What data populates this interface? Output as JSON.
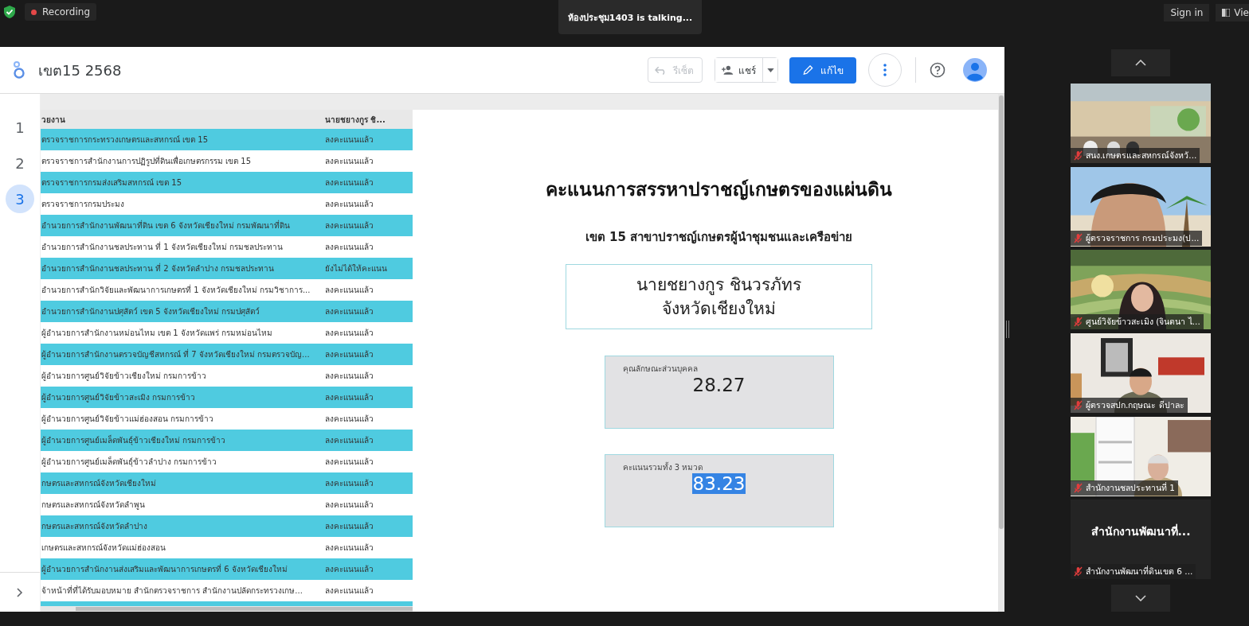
{
  "meeting_bar": {
    "recording": "Recording",
    "speaker": "ห้องประชุม1403 is talking...",
    "sign_in": "Sign in",
    "view": "Vie"
  },
  "report": {
    "title": "เขต15 2568",
    "toolbar": [
      {
        "kind": "reset",
        "label": "รีเซ็ต",
        "disabled": true
      },
      {
        "kind": "share",
        "label": "แชร์",
        "disabled": false
      },
      {
        "kind": "edit",
        "label": "แก้ไข",
        "disabled": false
      }
    ],
    "pages": [
      {
        "label": "1",
        "selected": false
      },
      {
        "label": "2",
        "selected": false
      },
      {
        "label": "3",
        "selected": true
      }
    ],
    "table": {
      "columns": [
        "วยงาน",
        "นายชยางกูร ชิ..."
      ],
      "rows": [
        {
          "cells": [
            "ตรวจราชการกระทรวงเกษตรและสหกรณ์ เขต 15",
            "ลงคะแนนแล้ว"
          ],
          "highlighted": true
        },
        {
          "cells": [
            "ตรวจราชการสำนักงานการปฏิรูปที่ดินเพื่อเกษตรกรรม เขต 15",
            "ลงคะแนนแล้ว"
          ],
          "highlighted": false
        },
        {
          "cells": [
            "ตรวจราชการกรมส่งเสริมสหกรณ์ เขต 15",
            "ลงคะแนนแล้ว"
          ],
          "highlighted": true
        },
        {
          "cells": [
            "ตรวจราชการกรมประมง",
            "ลงคะแนนแล้ว"
          ],
          "highlighted": false
        },
        {
          "cells": [
            "อำนวยการสำนักงานพัฒนาที่ดิน เขต 6 จังหวัดเชียงใหม่ กรมพัฒนาที่ดิน",
            "ลงคะแนนแล้ว"
          ],
          "highlighted": true
        },
        {
          "cells": [
            "อำนวยการสำนักงานชลประทาน ที่ 1 จังหวัดเชียงใหม่ กรมชลประทาน",
            "ลงคะแนนแล้ว"
          ],
          "highlighted": false
        },
        {
          "cells": [
            "อำนวยการสำนักงานชลประทาน ที่ 2 จังหวัดลำปาง กรมชลประทาน",
            "ยังไม่ได้ให้คะแนน"
          ],
          "highlighted": true
        },
        {
          "cells": [
            "อำนวยการสำนักวิจัยและพัฒนาการเกษตรที่ 1 จังหวัดเชียงใหม่ กรมวิชาการ...",
            "ลงคะแนนแล้ว"
          ],
          "highlighted": false
        },
        {
          "cells": [
            "อำนวยการสำนักงานปศุสัตว์ เขต 5 จังหวัดเชียงใหม่ กรมปศุสัตว์",
            "ลงคะแนนแล้ว"
          ],
          "highlighted": true
        },
        {
          "cells": [
            "ผู้อำนวยการสำนักงานหม่อนไหม เขต 1 จังหวัดแพร่ กรมหม่อนไหม",
            "ลงคะแนนแล้ว"
          ],
          "highlighted": false
        },
        {
          "cells": [
            "ผู้อำนวยการสำนักงานตรวจบัญชีสหกรณ์ ที่ 7 จังหวัดเชียงใหม่ กรมตรวจบัญ...",
            "ลงคะแนนแล้ว"
          ],
          "highlighted": true
        },
        {
          "cells": [
            "ผู้อำนวยการศูนย์วิจัยข้าวเชียงใหม่ กรมการข้าว",
            "ลงคะแนนแล้ว"
          ],
          "highlighted": false
        },
        {
          "cells": [
            "ผู้อำนวยการศูนย์วิจัยข้าวสะเมิง กรมการข้าว",
            "ลงคะแนนแล้ว"
          ],
          "highlighted": true
        },
        {
          "cells": [
            "ผู้อำนวยการศูนย์วิจัยข้าวแม่ฮ่องสอน กรมการข้าว",
            "ลงคะแนนแล้ว"
          ],
          "highlighted": false
        },
        {
          "cells": [
            "ผู้อำนวยการศูนย์เมล็ดพันธุ์ข้าวเชียงใหม่ กรมการข้าว",
            "ลงคะแนนแล้ว"
          ],
          "highlighted": true
        },
        {
          "cells": [
            "ผู้อำนวยการศูนย์เมล็ดพันธุ์ข้าวลำปาง กรมการข้าว",
            "ลงคะแนนแล้ว"
          ],
          "highlighted": false
        },
        {
          "cells": [
            "กษตรและสหกรณ์จังหวัดเชียงใหม่",
            "ลงคะแนนแล้ว"
          ],
          "highlighted": true
        },
        {
          "cells": [
            "กษตรและสหกรณ์จังหวัดลำพูน",
            "ลงคะแนนแล้ว"
          ],
          "highlighted": false
        },
        {
          "cells": [
            "กษตรและสหกรณ์จังหวัดลำปาง",
            "ลงคะแนนแล้ว"
          ],
          "highlighted": true
        },
        {
          "cells": [
            "เกษตรและสหกรณ์จังหวัดแม่ฮ่องสอน",
            "ลงคะแนนแล้ว"
          ],
          "highlighted": false
        },
        {
          "cells": [
            "ผู้อำนวยการสำนักงานส่งเสริมและพัฒนาการเกษตรที่ 6 จังหวัดเชียงใหม่",
            "ลงคะแนนแล้ว"
          ],
          "highlighted": true
        },
        {
          "cells": [
            "จ้าหน้าที่ที่ได้รับมอบหมาย สำนักตรวจราชการ สำนักงานปลัดกระทรวงเกษ...",
            "ลงคะแนนแล้ว"
          ],
          "highlighted": false
        }
      ]
    },
    "canvas": {
      "title": "คะแนนการสรรหาปราชญ์เกษตรของแผ่นดิน",
      "subtitle": "เขต 15 สาขาปราชญ์เกษตรผู้นำชุมชนและเครือข่าย",
      "name_lines": [
        "นายชยางกูร ชินวรภัทร",
        "จังหวัดเชียงใหม่"
      ],
      "scores": [
        {
          "label": "คุณลักษณะส่วนบุคคล",
          "value": "28.27",
          "text_selected": false
        },
        {
          "label": "คะแนนรวมทั้ง 3 หมวด",
          "value": "83.23",
          "text_selected": true
        }
      ]
    }
  },
  "participants": [
    {
      "kind": "video",
      "name": "สนง.เกษตรและสหกรณ์จังหวั..."
    },
    {
      "kind": "video",
      "name": "ผู้ตรวจราชการ กรมประมง(ป..."
    },
    {
      "kind": "video",
      "name": "ศูนย์วิจัยข้าวสะเมิง (จินตนา ไ..."
    },
    {
      "kind": "video",
      "name": "ผู้ตรวจสปก.กฤษณะ ดีปาละ"
    },
    {
      "kind": "video",
      "name": "สำนักงานชลประทานที่ 1"
    },
    {
      "kind": "name_only",
      "display": "สำนักงานพัฒนาที่...",
      "name": "สำนักงานพัฒนาที่ดินเขต 6 ..."
    }
  ]
}
